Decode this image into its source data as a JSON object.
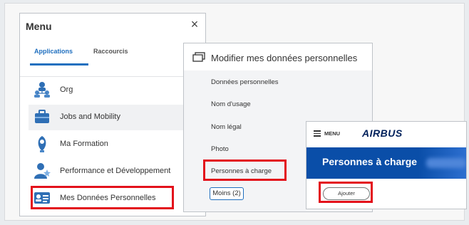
{
  "menu": {
    "title": "Menu",
    "close_symbol": "×",
    "tabs": [
      {
        "label": "Applications",
        "active": true
      },
      {
        "label": "Raccourcis",
        "active": false
      }
    ],
    "items": [
      {
        "label": "Org",
        "icon": "org-chart-icon"
      },
      {
        "label": "Jobs and Mobility",
        "icon": "briefcase-icon"
      },
      {
        "label": "Ma Formation",
        "icon": "training-icon"
      },
      {
        "label": "Performance et Développement",
        "icon": "performance-icon"
      },
      {
        "label": "Mes Données Personnelles",
        "icon": "id-card-icon",
        "highlighted": true
      }
    ]
  },
  "modifier": {
    "title": "Modifier mes données personnelles",
    "items": [
      {
        "label": "Données personnelles"
      },
      {
        "label": "Nom d'usage"
      },
      {
        "label": "Nom légal"
      },
      {
        "label": "Photo"
      },
      {
        "label": "Personnes à charge",
        "highlighted": true
      }
    ],
    "less_button": "Moins (2)"
  },
  "airbus": {
    "menu_label": "MENU",
    "logo": "AIRBUS",
    "page_title": "Personnes à charge",
    "add_button": "Ajouter"
  },
  "colors": {
    "accent_blue": "#1f6fbf",
    "highlight_red": "#e3111b",
    "airbus_navy": "#00205b",
    "banner_blue": "#0a4ea8"
  }
}
